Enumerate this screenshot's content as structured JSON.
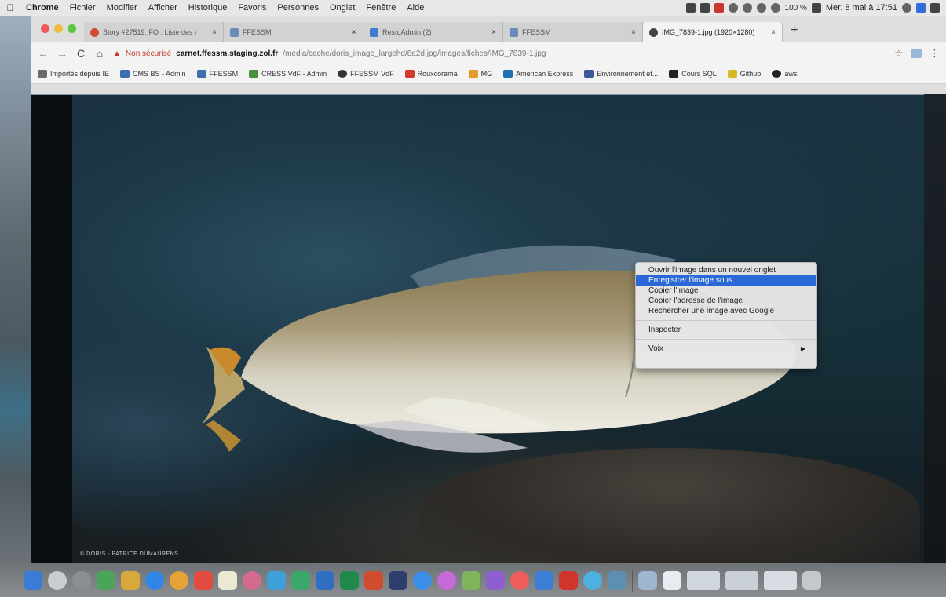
{
  "menubar": {
    "apple": "",
    "items": [
      "Chrome",
      "Fichier",
      "Modifier",
      "Afficher",
      "Historique",
      "Favoris",
      "Personnes",
      "Onglet",
      "Fenêtre",
      "Aide"
    ],
    "battery": "100 %",
    "clock": "Mer. 8 mai à 17:51"
  },
  "tabs": [
    {
      "title": "Story #27519: FO : Liste des i",
      "icon": "github-icon"
    },
    {
      "title": "FFESSM",
      "icon": "cms-icon"
    },
    {
      "title": "RestoAdmin (2)",
      "icon": "doc-icon"
    },
    {
      "title": "FFESSM",
      "icon": "cms-icon"
    },
    {
      "title": "IMG_7839-1.jpg (1920×1280)",
      "icon": "chrome-icon"
    }
  ],
  "toolbar": {
    "back": "←",
    "forward": "→",
    "reload": "C",
    "home": "⌂",
    "warning": "▲",
    "not_secure": "Non sécurisé",
    "url_host": "carnet.ffessm.staging.zol.fr",
    "url_path": "/media/cache/doris_image_largehd/8a2d.jpg/images/fiches/IMG_7839-1.jpg",
    "star": "☆",
    "menu": "⋮"
  },
  "bookmarks": [
    {
      "label": "Importés depuis IE",
      "icon": "apps-icon"
    },
    {
      "label": "CMS BS - Admin",
      "icon": "cms-icon"
    },
    {
      "label": "FFESSM",
      "icon": "cms-icon"
    },
    {
      "label": "CRESS VdF - Admin",
      "icon": "crm-icon"
    },
    {
      "label": "FFESSM VdF",
      "icon": "chrome-icon"
    },
    {
      "label": "Rouxcorama",
      "icon": "rz-icon"
    },
    {
      "label": "MG",
      "icon": "mg-icon"
    },
    {
      "label": "American Express",
      "icon": "amex-icon"
    },
    {
      "label": "Environnement et...",
      "icon": "fb-icon"
    },
    {
      "label": "Cours SQL",
      "icon": "sql-icon"
    },
    {
      "label": "Github",
      "icon": "gh-icon"
    },
    {
      "label": "aws",
      "icon": "github-icon"
    }
  ],
  "photo": {
    "watermark": "© DORIS - PATRICE DUMAURENS"
  },
  "context_menu": {
    "items": [
      {
        "label": "Ouvrir l'image dans un nouvel onglet",
        "highlight": false
      },
      {
        "label": "Enregistrer l'image sous...",
        "highlight": true
      },
      {
        "label": "Copier l'image",
        "highlight": false
      },
      {
        "label": "Copier l'adresse de l'image",
        "highlight": false
      },
      {
        "label": "Rechercher une image avec Google",
        "highlight": false
      }
    ],
    "inspect": "Inspecter",
    "services": "Voix",
    "submenu_arrow": "▶"
  },
  "colors": {
    "menu_highlight": "#2a68d8",
    "not_secure": "#c0392b"
  }
}
